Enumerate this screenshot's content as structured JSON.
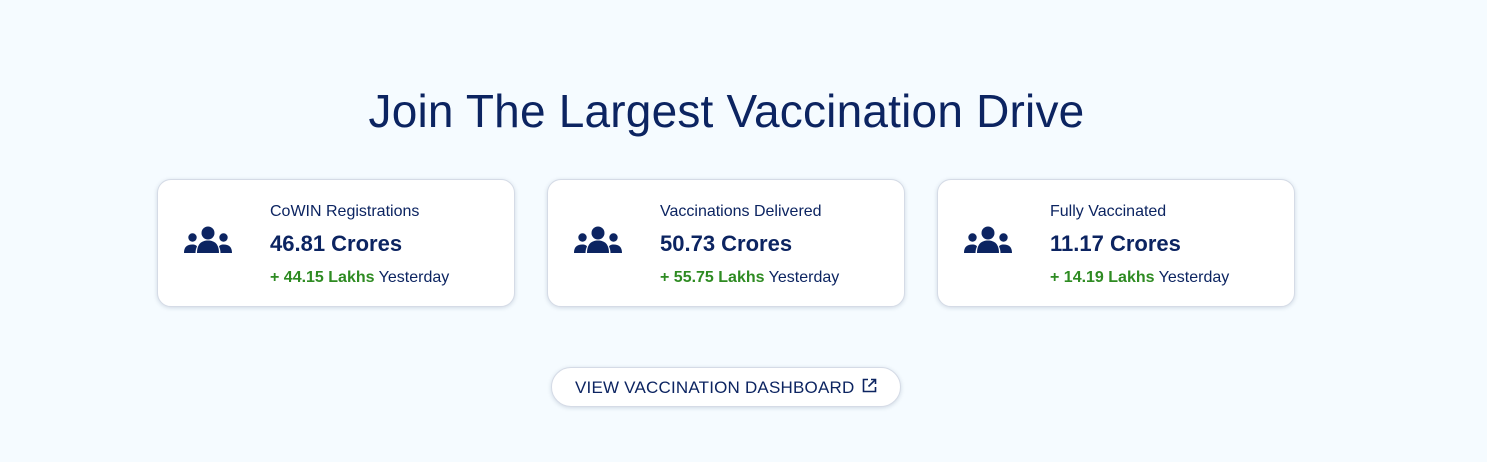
{
  "headline": "Join The Largest Vaccination Drive",
  "colors": {
    "background": "#f5fbff",
    "navy": "#0c2461",
    "green": "#2e8b22",
    "card": "#ffffff"
  },
  "stats": [
    {
      "icon": "people-group-icon",
      "label": "CoWIN Registrations",
      "value": "46.81 Crores",
      "delta": "+ 44.15 Lakhs",
      "delta_suffix": "Yesterday"
    },
    {
      "icon": "people-group-icon",
      "label": "Vaccinations Delivered",
      "value": "50.73 Crores",
      "delta": "+ 55.75 Lakhs",
      "delta_suffix": "Yesterday"
    },
    {
      "icon": "people-group-icon",
      "label": "Fully Vaccinated",
      "value": "11.17 Crores",
      "delta": "+ 14.19 Lakhs",
      "delta_suffix": "Yesterday"
    }
  ],
  "dashboard_button": {
    "label": "VIEW VACCINATION DASHBOARD",
    "icon": "external-link-icon"
  }
}
